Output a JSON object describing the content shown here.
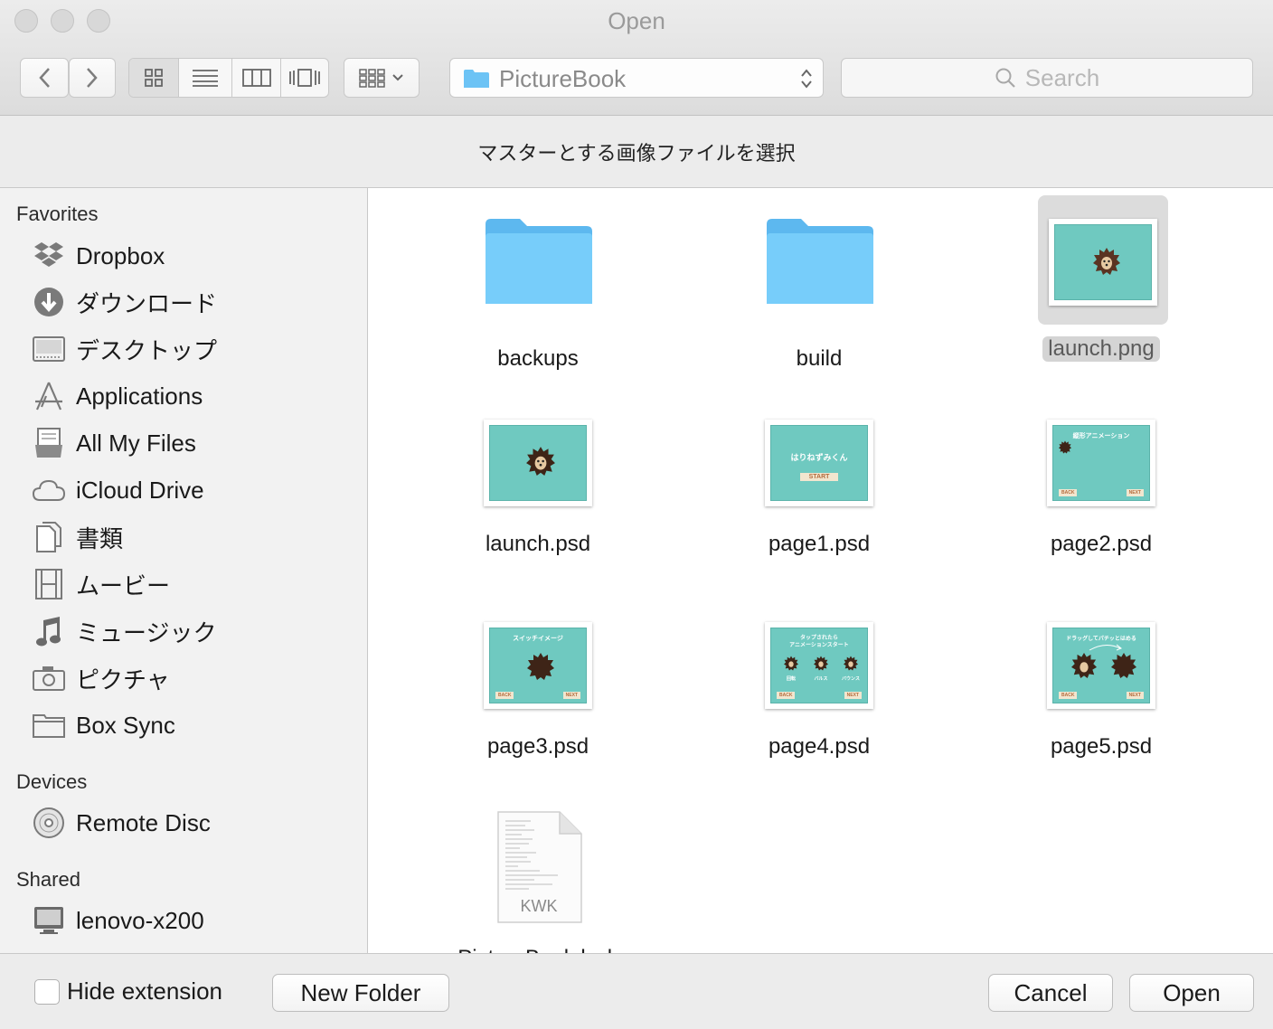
{
  "window": {
    "title": "Open"
  },
  "toolbar": {
    "path_label": "PictureBook",
    "search_placeholder": "Search"
  },
  "message": "マスターとする画像ファイルを選択",
  "sidebar": {
    "favorites_heading": "Favorites",
    "favorites": [
      {
        "label": "Dropbox",
        "icon": "dropbox-icon"
      },
      {
        "label": "ダウンロード",
        "icon": "download-icon"
      },
      {
        "label": "デスクトップ",
        "icon": "desktop-icon"
      },
      {
        "label": "Applications",
        "icon": "applications-icon"
      },
      {
        "label": "All My Files",
        "icon": "all-files-icon"
      },
      {
        "label": "iCloud Drive",
        "icon": "cloud-icon"
      },
      {
        "label": "書類",
        "icon": "documents-icon"
      },
      {
        "label": "ムービー",
        "icon": "movies-icon"
      },
      {
        "label": "ミュージック",
        "icon": "music-icon"
      },
      {
        "label": "ピクチャ",
        "icon": "camera-icon"
      },
      {
        "label": "Box Sync",
        "icon": "folder-icon"
      }
    ],
    "devices_heading": "Devices",
    "devices": [
      {
        "label": "Remote Disc",
        "icon": "disc-icon"
      }
    ],
    "shared_heading": "Shared",
    "shared": [
      {
        "label": "lenovo-x200",
        "icon": "computer-icon"
      }
    ]
  },
  "files": [
    {
      "name": "backups",
      "kind": "folder"
    },
    {
      "name": "build",
      "kind": "folder"
    },
    {
      "name": "launch.png",
      "kind": "image",
      "selected": true
    },
    {
      "name": "launch.psd",
      "kind": "image"
    },
    {
      "name": "page1.psd",
      "kind": "image",
      "thumb_title": "はりねずみくん",
      "thumb_button": "START"
    },
    {
      "name": "page2.psd",
      "kind": "image",
      "thumb_title": "縦形アニメーション",
      "thumb_back": "BACK",
      "thumb_next": "NEXT"
    },
    {
      "name": "page3.psd",
      "kind": "image",
      "thumb_title": "スイッチイメージ",
      "thumb_back": "BACK",
      "thumb_next": "NEXT"
    },
    {
      "name": "page4.psd",
      "kind": "image",
      "thumb_title_1": "タップされたら",
      "thumb_title_2": "アニメーションスタート",
      "thumb_labels": [
        "回転",
        "バルス",
        "バウンス"
      ],
      "thumb_back": "BACK",
      "thumb_next": "NEXT"
    },
    {
      "name": "page5.psd",
      "kind": "image",
      "thumb_title": "ドラッグしてパチッとはめる",
      "thumb_back": "BACK",
      "thumb_next": "NEXT"
    },
    {
      "name": "PictureBook.kwk",
      "kind": "document",
      "doc_label": "KWK"
    }
  ],
  "bottom": {
    "hide_extension_label": "Hide extension",
    "new_folder_label": "New Folder",
    "cancel_label": "Cancel",
    "open_label": "Open"
  },
  "colors": {
    "folder": "#6cc3f5",
    "thumb_teal": "#6fc9c0",
    "hedgehog": "#5a3422"
  }
}
